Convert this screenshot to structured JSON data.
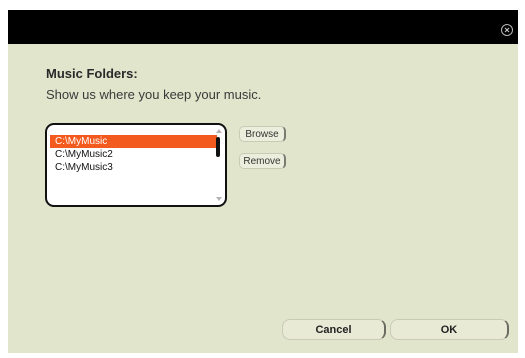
{
  "window": {
    "close_icon": "close-circle-icon"
  },
  "folders": {
    "heading": "Music Folders:",
    "subheading": "Show us where you keep your music.",
    "items": [
      {
        "label": "C:\\MyMusic",
        "selected": true
      },
      {
        "label": "C:\\MyMusic2",
        "selected": false
      },
      {
        "label": "C:\\MyMusic3",
        "selected": false
      }
    ],
    "browse_label": "Browse",
    "remove_label": "Remove"
  },
  "footer": {
    "cancel_label": "Cancel",
    "ok_label": "OK"
  },
  "colors": {
    "selection": "#f25a1e",
    "background": "#e1e5cc",
    "titlebar": "#000000"
  }
}
